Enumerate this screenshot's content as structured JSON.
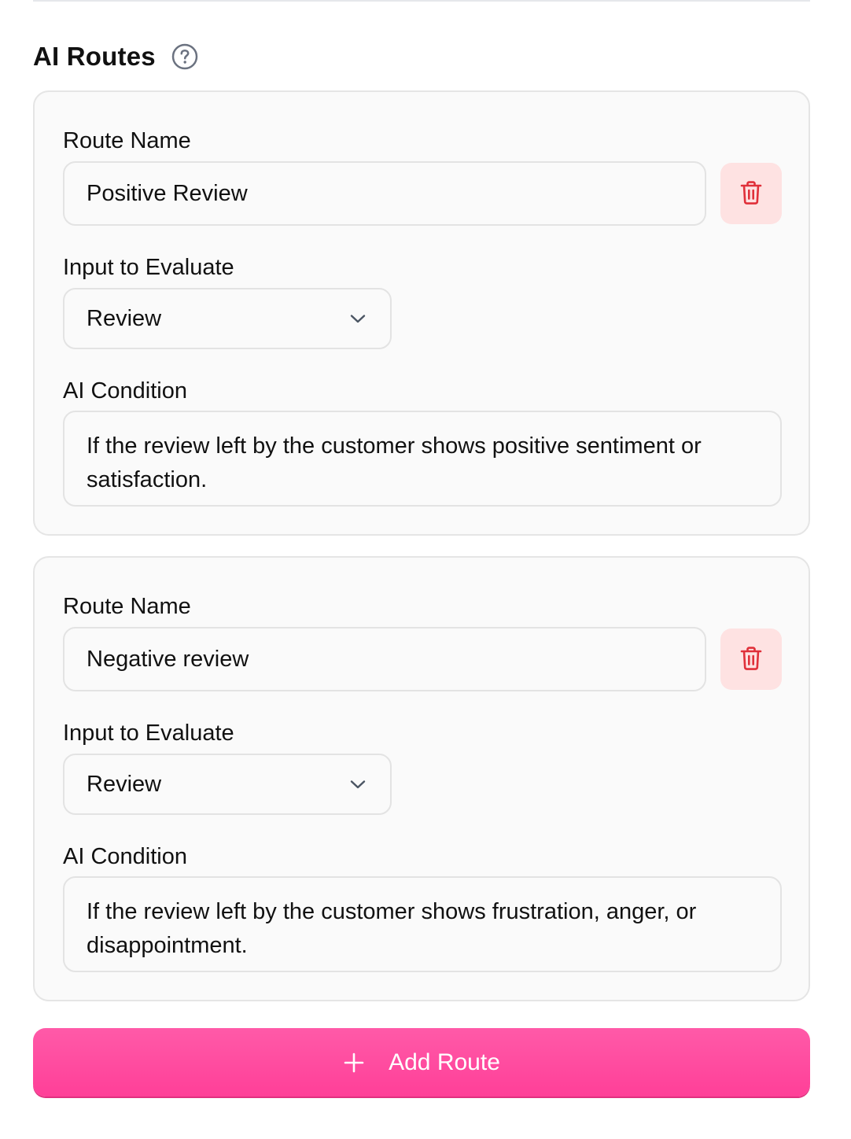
{
  "section": {
    "title": "AI Routes",
    "help_icon": "question-circle-icon"
  },
  "labels": {
    "route_name": "Route Name",
    "input_to_evaluate": "Input to Evaluate",
    "ai_condition": "AI Condition"
  },
  "routes": [
    {
      "name": "Positive Review",
      "input": "Review",
      "condition": "If the review left by the customer shows positive sentiment or satisfaction."
    },
    {
      "name": "Negative review",
      "input": "Review",
      "condition": "If the review left by the customer shows frustration, anger, or disappointment."
    }
  ],
  "add_route": {
    "label": "Add Route",
    "icon": "plus-icon"
  },
  "colors": {
    "accent": "#ff4da0",
    "delete_bg": "#fee2e2",
    "delete_icon": "#e0303a",
    "card_bg": "#fafafa",
    "border": "#e5e5e5"
  }
}
